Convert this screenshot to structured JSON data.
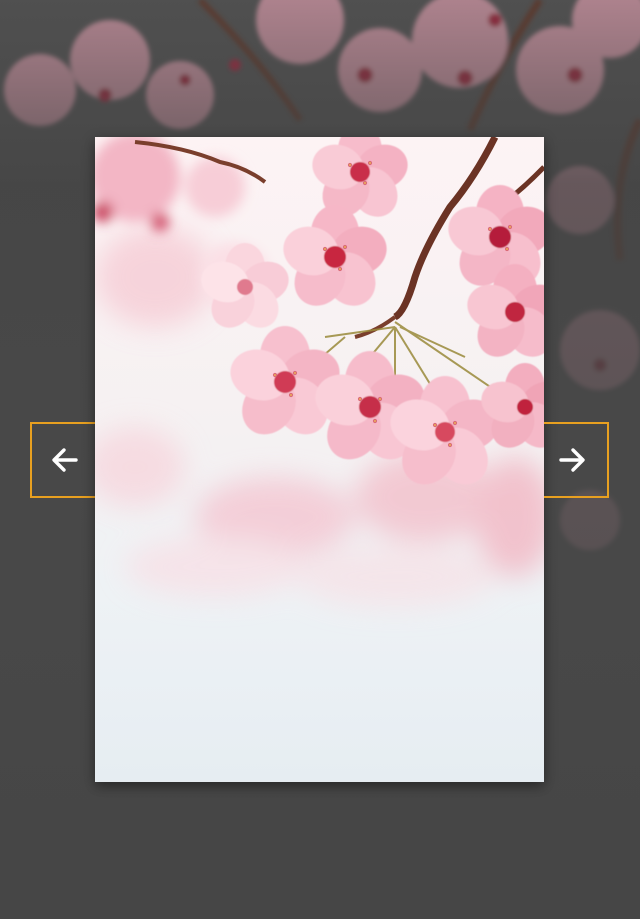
{
  "lightbox": {
    "prev_button": {
      "icon": "arrow-left-icon",
      "label": ""
    },
    "next_button": {
      "icon": "arrow-right-icon",
      "label": ""
    },
    "image": {
      "subject": "cherry-blossom-photo"
    }
  },
  "colors": {
    "overlay": "#444444",
    "nav_border": "#e8a020",
    "nav_icon": "#ffffff",
    "blossom_pink": "#f4b6c8",
    "blossom_center": "#c8283c"
  }
}
